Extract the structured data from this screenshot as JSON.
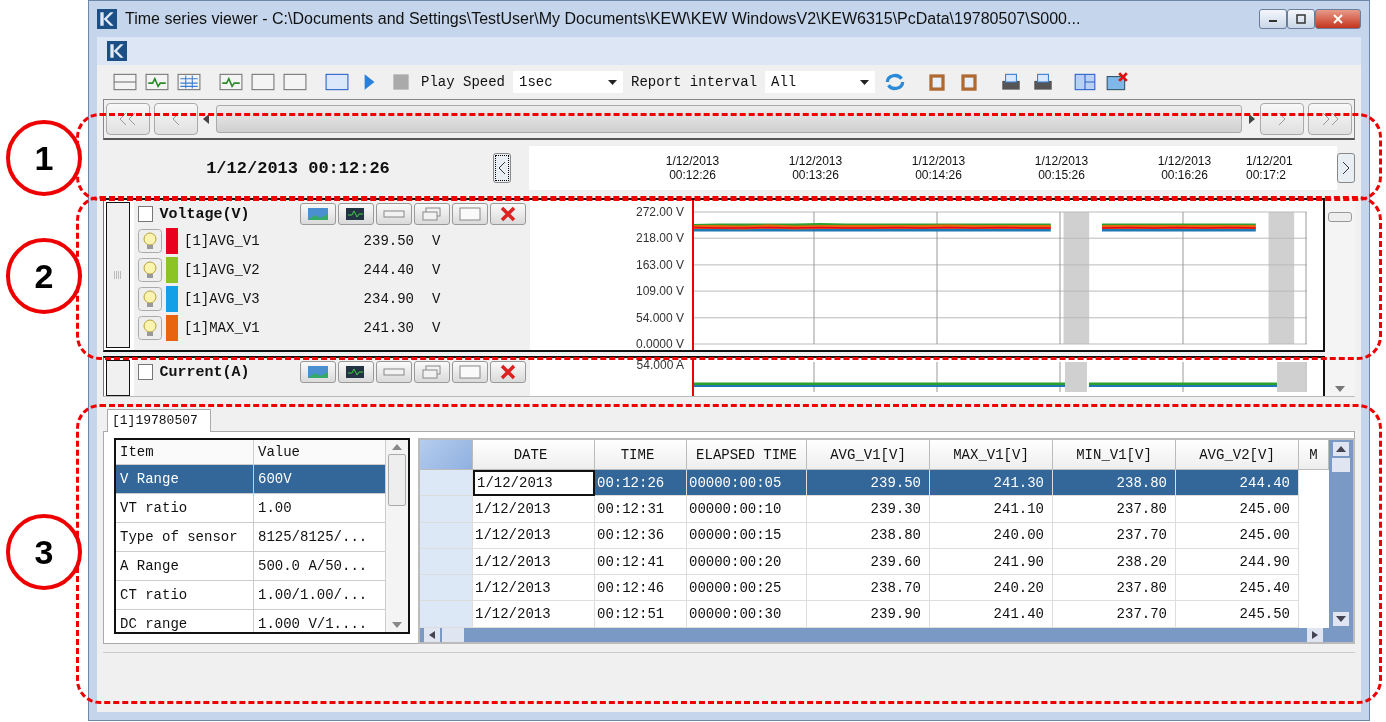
{
  "window": {
    "title": "Time series viewer - C:\\Documents and Settings\\TestUser\\My Documents\\KEW\\KEW WindowsV2\\KEW6315\\PcData\\19780507\\S000..."
  },
  "toolbar": {
    "play_speed_label": "Play Speed",
    "play_speed_value": "1sec",
    "report_interval_label": "Report interval",
    "report_interval_value": "All"
  },
  "time_header": {
    "current": "1/12/2013 00:12:26",
    "ticks": [
      {
        "date": "1/12/2013",
        "time": "00:12:26"
      },
      {
        "date": "1/12/2013",
        "time": "00:13:26"
      },
      {
        "date": "1/12/2013",
        "time": "00:14:26"
      },
      {
        "date": "1/12/2013",
        "time": "00:15:26"
      },
      {
        "date": "1/12/2013",
        "time": "00:16:26"
      },
      {
        "date": "1/12/201",
        "time": "00:17:2"
      }
    ]
  },
  "graphs": [
    {
      "title": "Voltage(V)",
      "checked": false,
      "channels": [
        {
          "value": "239.50",
          "unit": "V",
          "color": "#e8001c"
        },
        {
          "value": "244.40",
          "unit": "V",
          "color": "#8cc426"
        },
        {
          "value": "234.90",
          "unit": "V",
          "color": "#14a0e6"
        },
        {
          "value": "241.30",
          "unit": "V",
          "color": "#e8640e"
        }
      ],
      "chart_data": {
        "type": "line",
        "grid": true,
        "ylim": [
          0,
          272
        ],
        "yticks": [
          {
            "value": 272,
            "label": "272.00 V"
          },
          {
            "value": 218,
            "label": "218.00 V"
          },
          {
            "value": 163,
            "label": "163.00 V"
          },
          {
            "value": 109,
            "label": "109.00 V"
          },
          {
            "value": 54,
            "label": "54.000 V"
          },
          {
            "value": 0,
            "label": "0.0000 V"
          }
        ],
        "series": [
          {
            "name": "[1]AVG_V1",
            "color": "#e8001c",
            "values": [
              240,
              239,
              239,
              240,
              239,
              240,
              239,
              239,
              240,
              239,
              240,
              239,
              240,
              239,
              239,
              null,
              239,
              240,
              239,
              240,
              239,
              240,
              239,
              null,
              240
            ]
          },
          {
            "name": "[1]AVG_V2",
            "color": "#2ca02c",
            "values": [
              244,
              245,
              245,
              245,
              245,
              246,
              245,
              245,
              245,
              245,
              245,
              245,
              245,
              245,
              245,
              null,
              245,
              245,
              245,
              245,
              245,
              245,
              245,
              null,
              245
            ]
          },
          {
            "name": "[1]AVG_V3",
            "color": "#1f77b4",
            "values": [
              235,
              235,
              235,
              235,
              235,
              235,
              235,
              235,
              235,
              235,
              235,
              235,
              235,
              235,
              235,
              null,
              235,
              235,
              235,
              235,
              235,
              235,
              235,
              null,
              235
            ]
          },
          {
            "name": "[1]MAX_V1",
            "color": "#e8640e",
            "values": [
              241,
              241,
              240,
              242,
              240,
              241,
              241,
              241,
              241,
              241,
              242,
              241,
              241,
              241,
              241,
              null,
              241,
              241,
              241,
              241,
              241,
              241,
              241,
              null,
              241
            ]
          }
        ]
      }
    },
    {
      "title": "Current(A)",
      "checked": false,
      "axis_label": "54.000 A"
    }
  ],
  "tabs": [
    {
      "label": "[1]19780507",
      "selected": true
    }
  ],
  "properties": {
    "columns": [
      "Item",
      "Value"
    ],
    "rows": [
      {
        "item": "V Range",
        "value": "600V",
        "selected": true
      },
      {
        "item": "VT ratio",
        "value": "1.00",
        "selected": false
      },
      {
        "item": "Type of sensor",
        "value": "8125/8125/...",
        "selected": false
      },
      {
        "item": "A Range",
        "value": "500.0 A/50...",
        "selected": false
      },
      {
        "item": "CT ratio",
        "value": "1.00/1.00/...",
        "selected": false
      },
      {
        "item": "DC range",
        "value": "1.000 V/1....",
        "selected": false
      }
    ]
  },
  "data_table": {
    "columns": [
      "DATE",
      "TIME",
      "ELAPSED TIME",
      "AVG_V1[V]",
      "MAX_V1[V]",
      "MIN_V1[V]",
      "AVG_V2[V]",
      "M"
    ],
    "rows": [
      {
        "selected": true,
        "focused": true,
        "cells": [
          "1/12/2013",
          "00:12:26",
          "00000:00:05",
          "239.50",
          "241.30",
          "238.80",
          "244.40"
        ]
      },
      {
        "selected": false,
        "cells": [
          "1/12/2013",
          "00:12:31",
          "00000:00:10",
          "239.30",
          "241.10",
          "237.80",
          "245.00"
        ]
      },
      {
        "selected": false,
        "cells": [
          "1/12/2013",
          "00:12:36",
          "00000:00:15",
          "238.80",
          "240.00",
          "237.70",
          "245.00"
        ]
      },
      {
        "selected": false,
        "cells": [
          "1/12/2013",
          "00:12:41",
          "00000:00:20",
          "239.60",
          "241.90",
          "238.20",
          "244.90"
        ]
      },
      {
        "selected": false,
        "cells": [
          "1/12/2013",
          "00:12:46",
          "00000:00:25",
          "238.70",
          "240.20",
          "237.80",
          "245.40"
        ]
      },
      {
        "selected": false,
        "cells": [
          "1/12/2013",
          "00:12:51",
          "00000:00:30",
          "239.90",
          "241.40",
          "237.70",
          "245.50"
        ]
      }
    ]
  },
  "callouts": [
    {
      "label": "1"
    },
    {
      "label": "2"
    },
    {
      "label": "3"
    }
  ]
}
